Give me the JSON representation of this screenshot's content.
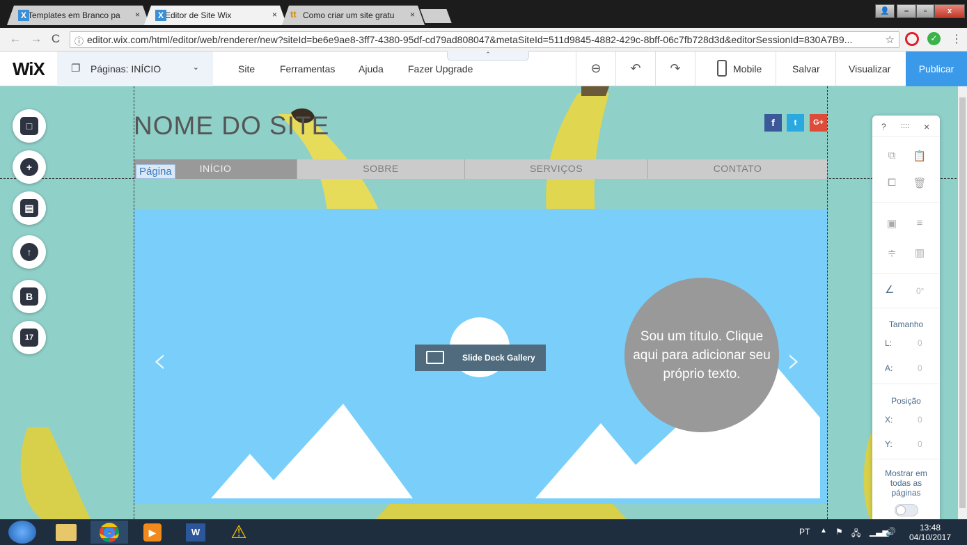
{
  "browser": {
    "tabs": [
      {
        "title": "Templates em Branco pa",
        "favicon": "wix-favicon-icon",
        "active": false
      },
      {
        "title": "Editor de Site Wix",
        "favicon": "wix-favicon-icon",
        "active": true
      },
      {
        "title": "Como criar um site gratu",
        "favicon": "tt-favicon-icon",
        "active": false
      }
    ],
    "close_glyph": "×",
    "window_buttons": [
      "–",
      "▫",
      "x"
    ],
    "url": "editor.wix.com/html/editor/web/renderer/new?siteId=be6e9ae8-3ff7-4380-95df-cd79ad808047&metaSiteId=511d9845-4882-429c-8bff-06c7fb728d3d&editorSessionId=830A7B9..."
  },
  "editor": {
    "logo": "WiX",
    "pages_label": "Páginas: INÍCIO",
    "menu": [
      "Site",
      "Ferramentas",
      "Ajuda",
      "Fazer Upgrade"
    ],
    "mobile_label": "Mobile",
    "save_label": "Salvar",
    "preview_label": "Visualizar",
    "publish_label": "Publicar"
  },
  "site": {
    "name": "NOME DO SITE",
    "page_tag": "Página",
    "menu": [
      "INÍCIO",
      "SOBRE",
      "SERVIÇOS",
      "CONTATO"
    ],
    "gallery_label": "Slide Deck Gallery",
    "bubble_text": "Sou um título. Clique aqui para adicionar seu próprio texto.",
    "social": [
      "f",
      "t",
      "G+"
    ]
  },
  "panel": {
    "help": "?",
    "grip": "::::",
    "close": "×",
    "angle": "0°",
    "size_title": "Tamanho",
    "w_label": "L:",
    "w_value": "0",
    "h_label": "A:",
    "h_value": "0",
    "pos_title": "Posição",
    "x_label": "X:",
    "x_value": "0",
    "y_label": "Y:",
    "y_value": "0",
    "show_all": "Mostrar em todas as páginas"
  },
  "taskbar": {
    "lang": "PT",
    "time": "13:48",
    "date": "04/10/2017"
  },
  "colors": {
    "canvas_bg": "#8fd0c9",
    "slider_bg": "#79cffa",
    "publish": "#3b99ea",
    "bubble": "#999999"
  }
}
